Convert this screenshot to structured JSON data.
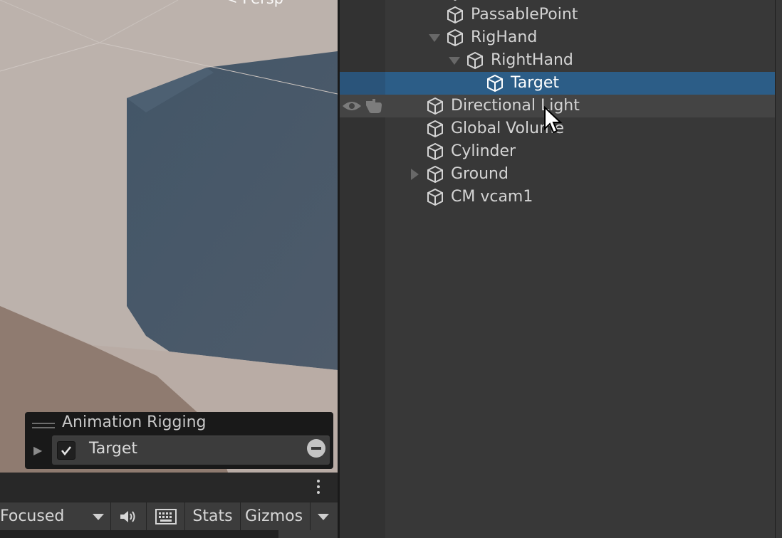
{
  "scene_view": {
    "perspective_label": "< Persp",
    "overlay": {
      "title": "Animation Rigging",
      "row": {
        "label": "Target",
        "enabled": true
      }
    }
  },
  "game_toolbar": {
    "play_focus": "Focused",
    "stats_label": "Stats",
    "gizmos_label": "Gizmos"
  },
  "hierarchy": {
    "items": [
      {
        "label": "PassablePoint",
        "expander": "none"
      },
      {
        "label": "RigHand",
        "expander": "expanded"
      },
      {
        "label": "RightHand",
        "expander": "expanded"
      },
      {
        "label": "Target",
        "expander": "none",
        "selected": true
      },
      {
        "label": "Directional Light",
        "expander": "none",
        "hovered": true
      },
      {
        "label": "Global Volume",
        "expander": "none"
      },
      {
        "label": "Cylinder",
        "expander": "none"
      },
      {
        "label": "Ground",
        "expander": "collapsed"
      },
      {
        "label": "CM vcam1",
        "expander": "none"
      }
    ]
  },
  "colors": {
    "selection": "#2c5d87",
    "panel_bg": "#383838",
    "toolbar_bg": "#3c3c3c"
  },
  "icons": [
    "gameobject-cube-icon",
    "eye-icon",
    "hand-pick-icon",
    "mute-audio-icon",
    "keyboard-icon",
    "kebab-menu-icon",
    "checkbox-icon",
    "remove-icon",
    "mouse-cursor-icon"
  ]
}
